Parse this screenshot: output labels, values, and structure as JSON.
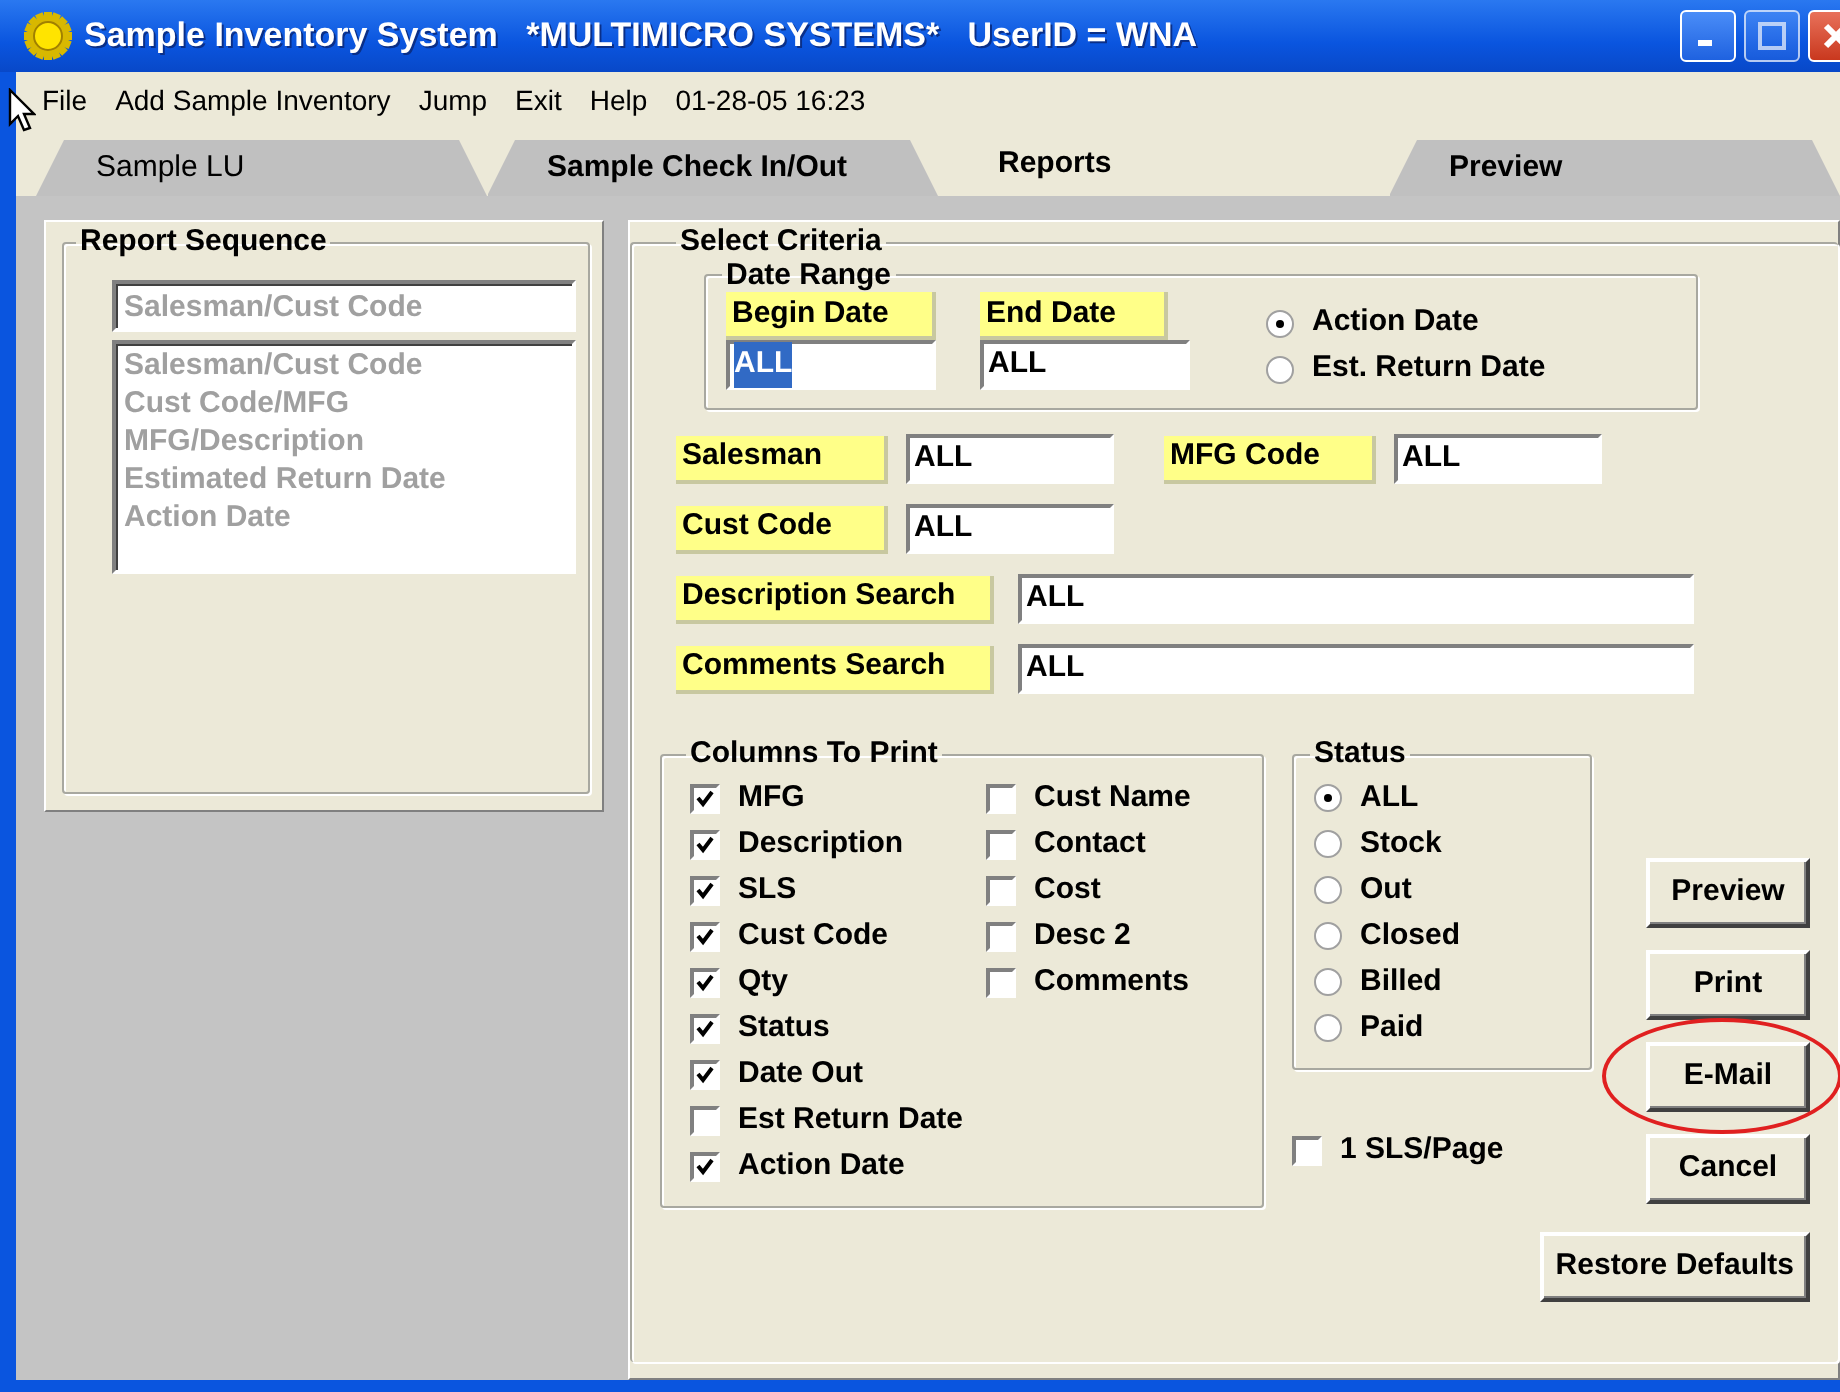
{
  "window": {
    "title": "Sample Inventory System   *MULTIMICRO SYSTEMS*   UserID = WNA"
  },
  "menu": [
    "File",
    "Add Sample Inventory",
    "Jump",
    "Exit",
    "Help"
  ],
  "menu_clock": "01-28-05 16:23",
  "tabs": [
    {
      "label": "Sample LU",
      "selected": false
    },
    {
      "label": "Sample Check In/Out",
      "selected": false
    },
    {
      "label": "Reports",
      "selected": true
    },
    {
      "label": "Preview",
      "selected": false
    }
  ],
  "report_sequence": {
    "title": "Report Sequence",
    "disabled": true,
    "combo_value": "Salesman/Cust Code",
    "options": [
      "Salesman/Cust Code",
      "Cust Code/MFG",
      "MFG/Description",
      "Estimated Return Date",
      "Action Date"
    ]
  },
  "select_criteria": {
    "title": "Select Criteria",
    "date_range": {
      "title": "Date Range",
      "fields": [
        {
          "label": "Begin Date",
          "value": "ALL",
          "text_selected": true
        },
        {
          "label": "End Date",
          "value": "ALL",
          "text_selected": false
        }
      ],
      "date_types": [
        {
          "label": "Action Date",
          "selected": true
        },
        {
          "label": "Est. Return Date",
          "selected": false
        }
      ]
    },
    "field_rows": [
      [
        {
          "label": "Salesman",
          "value": "ALL",
          "kind": "short"
        },
        {
          "label": "MFG Code",
          "value": "ALL",
          "kind": "short"
        }
      ],
      [
        {
          "label": "Cust Code",
          "value": "ALL",
          "kind": "short"
        }
      ],
      [
        {
          "label": "Description Search",
          "value": "ALL",
          "kind": "wide"
        }
      ],
      [
        {
          "label": "Comments Search",
          "value": "ALL",
          "kind": "wide"
        }
      ]
    ]
  },
  "columns_to_print": {
    "title": "Columns To Print",
    "columns": [
      [
        {
          "label": "MFG",
          "checked": true
        },
        {
          "label": "Description",
          "checked": true
        },
        {
          "label": "SLS",
          "checked": true
        },
        {
          "label": "Cust Code",
          "checked": true
        },
        {
          "label": "Qty",
          "checked": true
        },
        {
          "label": "Status",
          "checked": true
        },
        {
          "label": "Date Out",
          "checked": true
        },
        {
          "label": "Est Return Date",
          "checked": false
        },
        {
          "label": "Action Date",
          "checked": true
        }
      ],
      [
        {
          "label": "Cust Name",
          "checked": false
        },
        {
          "label": "Contact",
          "checked": false
        },
        {
          "label": "Cost",
          "checked": false
        },
        {
          "label": "Desc 2",
          "checked": false
        },
        {
          "label": "Comments",
          "checked": false
        }
      ]
    ]
  },
  "status": {
    "title": "Status",
    "options": [
      {
        "label": "ALL",
        "selected": true
      },
      {
        "label": "Stock",
        "selected": false
      },
      {
        "label": "Out",
        "selected": false
      },
      {
        "label": "Closed",
        "selected": false
      },
      {
        "label": "Billed",
        "selected": false
      },
      {
        "label": "Paid",
        "selected": false
      }
    ]
  },
  "one_sls_per_page": {
    "label": "1 SLS/Page",
    "checked": false
  },
  "buttons": [
    {
      "label": "Preview",
      "circled": false
    },
    {
      "label": "Print",
      "circled": false
    },
    {
      "label": "E-Mail",
      "circled": true
    },
    {
      "label": "Cancel",
      "circled": false
    }
  ],
  "restore_button": {
    "label": "Restore Defaults"
  }
}
